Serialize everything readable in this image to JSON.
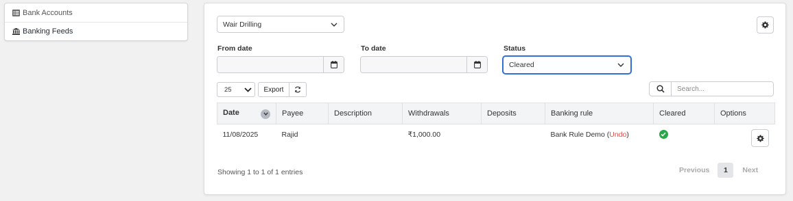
{
  "nav": {
    "items": [
      {
        "label": "Bank Accounts",
        "icon": "list-icon"
      },
      {
        "label": "Banking Feeds",
        "icon": "bank-icon"
      }
    ]
  },
  "filters": {
    "account_select": "Wair Drilling",
    "from_date_label": "From date",
    "from_date_value": "",
    "to_date_label": "To date",
    "to_date_value": "",
    "status_label": "Status",
    "status_value": "Cleared"
  },
  "toolbar": {
    "page_length": "25",
    "export_label": "Export",
    "search_placeholder": "Search..."
  },
  "table": {
    "columns": [
      "Date",
      "Payee",
      "Description",
      "Withdrawals",
      "Deposits",
      "Banking rule",
      "Cleared",
      "Options"
    ],
    "rows": [
      {
        "date": "11/08/2025",
        "payee": "Rajid",
        "description": "",
        "withdrawals": "₹1,000.00",
        "deposits": "",
        "banking_rule": "Bank Rule Demo",
        "undo_label": "Undo",
        "cleared": true
      }
    ]
  },
  "footer": {
    "info": "Showing 1 to 1 of 1 entries",
    "previous": "Previous",
    "current_page": "1",
    "next": "Next"
  },
  "colors": {
    "accent": "#2f6fd6",
    "cleared": "#28a745",
    "undo": "#d9534f"
  }
}
